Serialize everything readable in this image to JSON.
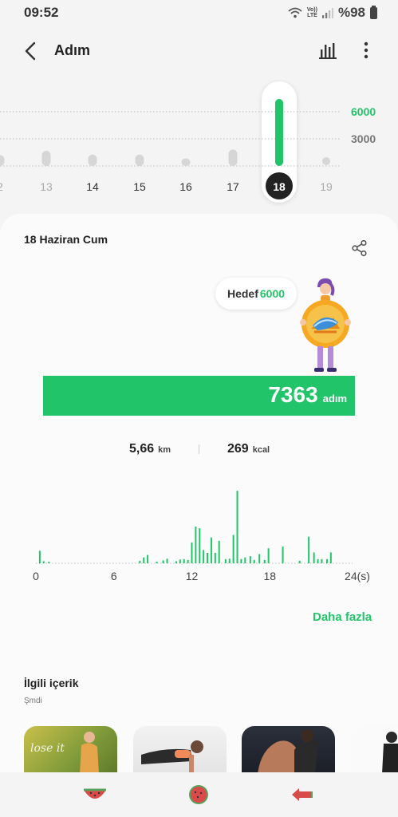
{
  "status_bar": {
    "time": "09:52",
    "network_label_top": "Vo))",
    "network_label_bottom": "LTE",
    "battery_text": "%98"
  },
  "app_bar": {
    "title": "Adım",
    "back_icon": "chevron-left-icon",
    "chart_icon": "bar-chart-icon",
    "more_icon": "more-vertical-icon"
  },
  "week_strip": {
    "goal_line_label": "6000",
    "mid_line_label": "3000",
    "days": [
      {
        "label": "2",
        "steps": 1700,
        "faded": true
      },
      {
        "label": "13",
        "steps": 2400,
        "faded": true
      },
      {
        "label": "14",
        "steps": 1800,
        "faded": false
      },
      {
        "label": "15",
        "steps": 1800,
        "faded": false
      },
      {
        "label": "16",
        "steps": 1200,
        "faded": false
      },
      {
        "label": "17",
        "steps": 2600,
        "faded": false
      },
      {
        "label": "18",
        "steps": 7363,
        "faded": false,
        "selected": true
      },
      {
        "label": "19",
        "steps": 0,
        "faded": true
      }
    ]
  },
  "card": {
    "date_title": "18 Haziran Cum",
    "share_icon": "share-icon",
    "goal_label": "Hedef",
    "goal_value": "6000",
    "progress_steps": "7363",
    "progress_unit": "adım",
    "distance_value": "5,66",
    "distance_unit": "km",
    "calories_value": "269",
    "calories_unit": "kcal",
    "more_link": "Daha fazla"
  },
  "hourly_chart": {
    "x_ticks": [
      "0",
      "6",
      "12",
      "18",
      "24(s)"
    ],
    "accent": "#22c46a"
  },
  "related": {
    "title": "İlgili içerik",
    "subtitle": "Şmdi",
    "thumb_text": "lose it"
  },
  "nav": {
    "left_icon": "watermelon-slice-icon",
    "center_icon": "watermelon-home-icon",
    "right_icon": "back-arrow-icon"
  },
  "colors": {
    "accent": "#22c46a",
    "bar_gray": "#d6d6d6"
  },
  "chart_data": {
    "type": "bar",
    "title": "",
    "xlabel": "",
    "ylabel": "",
    "x_ticks": [
      "0",
      "6",
      "12",
      "18",
      "24(s)"
    ],
    "xlim": [
      0,
      24
    ],
    "ylim": [
      0,
      900
    ],
    "values": [
      [
        0.3,
        150
      ],
      [
        0.6,
        25
      ],
      [
        1.0,
        20
      ],
      [
        8.0,
        30
      ],
      [
        8.3,
        70
      ],
      [
        8.6,
        100
      ],
      [
        9.3,
        20
      ],
      [
        9.8,
        35
      ],
      [
        10.1,
        55
      ],
      [
        10.8,
        25
      ],
      [
        11.1,
        45
      ],
      [
        11.4,
        50
      ],
      [
        11.7,
        40
      ],
      [
        12.0,
        250
      ],
      [
        12.3,
        440
      ],
      [
        12.6,
        420
      ],
      [
        12.9,
        160
      ],
      [
        13.2,
        125
      ],
      [
        13.5,
        310
      ],
      [
        13.8,
        125
      ],
      [
        14.1,
        270
      ],
      [
        14.6,
        50
      ],
      [
        14.9,
        55
      ],
      [
        15.2,
        340
      ],
      [
        15.5,
        870
      ],
      [
        15.8,
        50
      ],
      [
        16.1,
        70
      ],
      [
        16.5,
        85
      ],
      [
        16.8,
        40
      ],
      [
        17.2,
        110
      ],
      [
        17.6,
        40
      ],
      [
        17.9,
        180
      ],
      [
        19.0,
        200
      ],
      [
        20.3,
        30
      ],
      [
        21.0,
        320
      ],
      [
        21.4,
        130
      ],
      [
        21.7,
        50
      ],
      [
        22.0,
        50
      ],
      [
        22.4,
        50
      ],
      [
        22.7,
        130
      ]
    ]
  }
}
